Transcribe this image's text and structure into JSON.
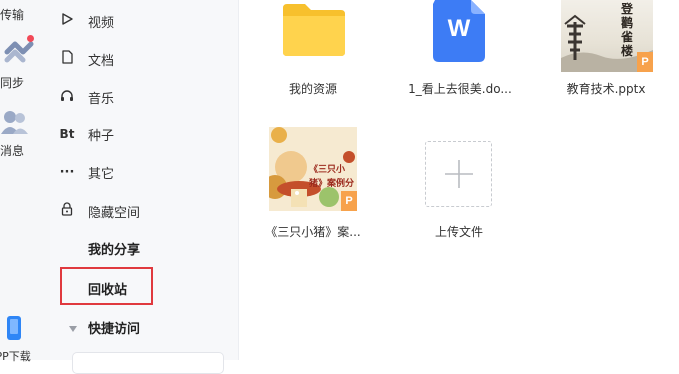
{
  "left_rail": {
    "items": [
      {
        "label": "传输"
      },
      {
        "label": "同步"
      },
      {
        "label": "消息"
      },
      {
        "label": "APP下载"
      }
    ]
  },
  "sidebar": {
    "items": [
      {
        "label": "视频",
        "icon": "video-icon"
      },
      {
        "label": "文档",
        "icon": "document-icon"
      },
      {
        "label": "音乐",
        "icon": "headphones-icon"
      },
      {
        "label": "种子",
        "icon": "bt-icon",
        "icon_text": "Bt"
      },
      {
        "label": "其它",
        "icon": "more-icon",
        "icon_text": "···"
      },
      {
        "label": "隐藏空间",
        "icon": "lock-icon"
      }
    ],
    "my_share": "我的分享",
    "recycle_bin": "回收站",
    "quick_access": "快捷访问"
  },
  "files": [
    {
      "name": "我的资源",
      "type": "folder"
    },
    {
      "name": "1_看上去很美.do...",
      "type": "word",
      "badge": "W"
    },
    {
      "name": "教育技术.pptx",
      "type": "pptx",
      "badge": "P",
      "thumb_text": "登鹳雀楼"
    },
    {
      "name": "《三只小猪》案...",
      "type": "pptx",
      "badge": "P",
      "thumb_text": "《三只小猪》案例分"
    }
  ],
  "upload": {
    "label": "上传文件"
  },
  "colors": {
    "folder": "#ffd34d",
    "word": "#3d7cf5",
    "ppt_badge": "#f7a24c",
    "highlight": "#e0393e",
    "notify_dot": "#f24957"
  }
}
